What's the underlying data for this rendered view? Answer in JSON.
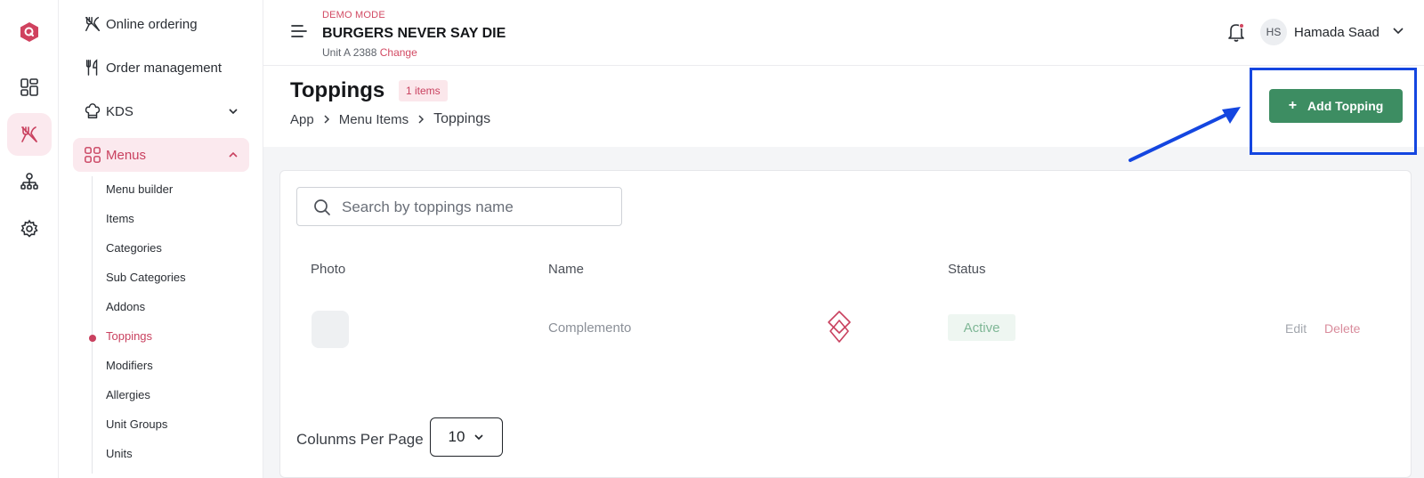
{
  "rail": {
    "logo_letter": "Q",
    "items": [
      {
        "icon": "dashboard-icon",
        "active": false
      },
      {
        "icon": "fork-knife-icon",
        "active": true
      },
      {
        "icon": "org-chart-icon",
        "active": false
      },
      {
        "icon": "gear-icon",
        "active": false
      }
    ]
  },
  "sidebar": {
    "items": [
      {
        "label": "Online ordering",
        "icon": "fork-knife-icon"
      },
      {
        "label": "Order management",
        "icon": "utensils-icon"
      },
      {
        "label": "KDS",
        "icon": "chef-hat-icon"
      },
      {
        "label": "Menus",
        "icon": "grid-icon",
        "active": true
      }
    ],
    "sub_items": [
      {
        "label": "Menu builder"
      },
      {
        "label": "Items"
      },
      {
        "label": "Categories"
      },
      {
        "label": "Sub Categories"
      },
      {
        "label": "Addons"
      },
      {
        "label": "Toppings",
        "active": true
      },
      {
        "label": "Modifiers"
      },
      {
        "label": "Allergies"
      },
      {
        "label": "Unit Groups"
      },
      {
        "label": "Units"
      }
    ]
  },
  "header": {
    "demo_label": "DEMO MODE",
    "store_name": "BURGERS NEVER SAY DIE",
    "unit_label": "Unit A 2388",
    "change_link": "Change",
    "user_initials": "HS",
    "user_name": "Hamada Saad"
  },
  "page": {
    "title": "Toppings",
    "count_badge": "1 items",
    "breadcrumbs": [
      "App",
      "Menu Items",
      "Toppings"
    ],
    "add_button": "Add Topping",
    "add_button_plus": "+"
  },
  "table": {
    "search_placeholder": "Search by toppings name",
    "columns": [
      "Photo",
      "Name",
      "Status"
    ],
    "rows": [
      {
        "name": "Complemento",
        "status": "Active",
        "actions": [
          "Edit",
          "Delete"
        ]
      }
    ]
  },
  "pagination": {
    "label": "Colunms Per Page",
    "value": "10"
  },
  "colors": {
    "brand": "#c9415f",
    "primary_button": "#3d8d62",
    "annotation": "#1446e0"
  }
}
